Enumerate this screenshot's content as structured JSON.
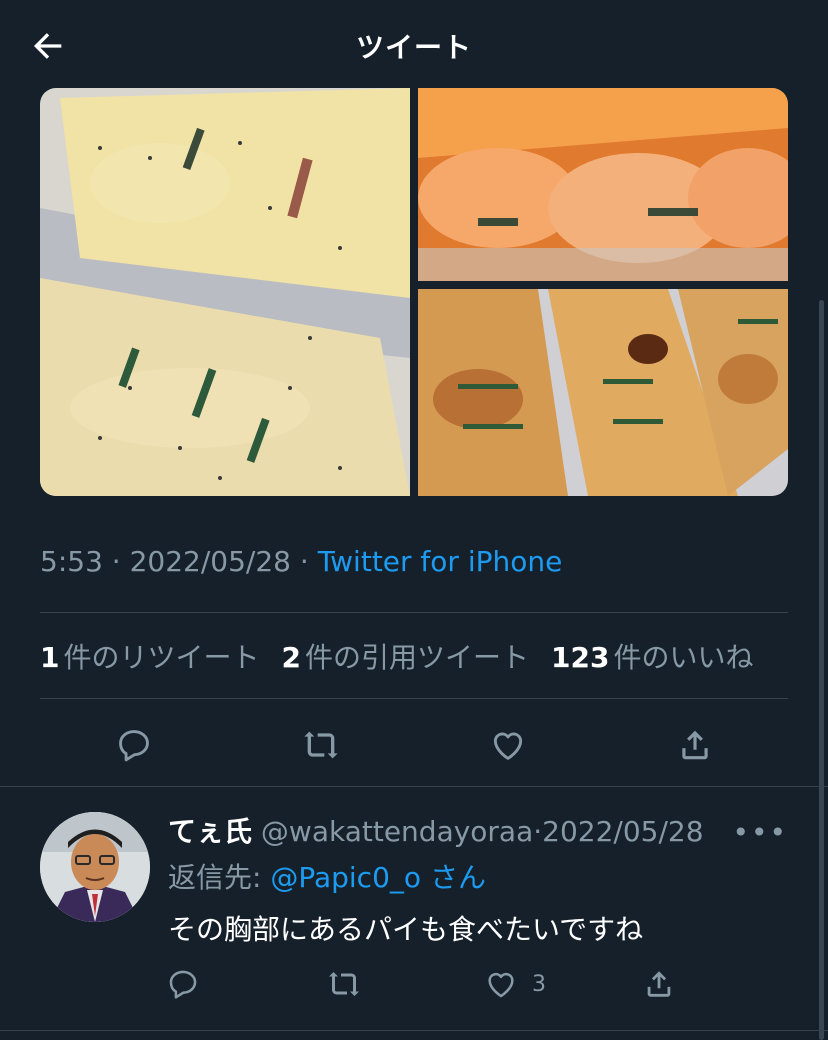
{
  "header": {
    "title": "ツイート",
    "back_icon": "arrow-left-icon"
  },
  "tweet": {
    "time": "5:53",
    "sep1": " · ",
    "date": "2022/05/28",
    "sep2": " · ",
    "source": "Twitter for iPhone",
    "retweets": {
      "count": "1",
      "label": "件のリツイート"
    },
    "quotes": {
      "count": "2",
      "label": "件の引用ツイート"
    },
    "likes": {
      "count": "123",
      "label": "件のいいね"
    }
  },
  "reply": {
    "name": "てぇ氏",
    "handle": "@wakattendayoraa",
    "dot": "·",
    "date": "2022/05/28",
    "more": "•••",
    "reply_to_prefix": "返信先: ",
    "reply_to_user": "@Papic0_o",
    "reply_to_suffix": "さん",
    "text": "その胸部にあるパイも食べたいですね",
    "like_count": "3"
  },
  "colors": {
    "background": "#15202b",
    "accent": "#1d9bf0",
    "muted": "#8899a6",
    "divider": "#38444d"
  }
}
